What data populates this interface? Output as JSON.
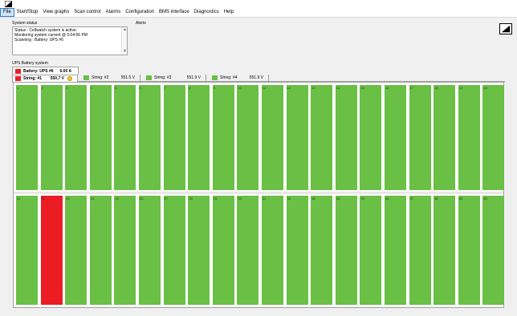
{
  "menu": [
    "File",
    "Start/Stop",
    "View graphs",
    "Scan control",
    "Alarms",
    "Configuration",
    "BMS interface",
    "Diagnostics",
    "Help"
  ],
  "system_status": {
    "label": "System status",
    "lines": [
      "Status : Cellwatch system is active.",
      "Monitoring system current @ 5:04:56 PM",
      "Scanning : Battery: UPS #6"
    ]
  },
  "alerts_label": "Alerts",
  "ups_label": "UPS Battery system",
  "battery": {
    "name": "Battery: UPS #6",
    "current": "6.00 A",
    "color": "#ec1c24"
  },
  "strings": [
    {
      "name": "String: #1",
      "voltage": "550.7 V",
      "color": "#ec1c24",
      "warning": true
    },
    {
      "name": "String: #2",
      "voltage": "551.5 V",
      "color": "#6abf45"
    },
    {
      "name": "String: #3",
      "voltage": "551.9 V",
      "color": "#6abf45"
    },
    {
      "name": "String: #4",
      "voltage": "551.9 V",
      "color": "#6abf45"
    }
  ],
  "cells": [
    {
      "n": "1",
      "status": "ok"
    },
    {
      "n": "2",
      "status": "ok"
    },
    {
      "n": "3",
      "status": "ok"
    },
    {
      "n": "4",
      "status": "ok"
    },
    {
      "n": "5",
      "status": "ok"
    },
    {
      "n": "6",
      "status": "ok"
    },
    {
      "n": "7",
      "status": "ok"
    },
    {
      "n": "8",
      "status": "ok"
    },
    {
      "n": "9",
      "status": "ok"
    },
    {
      "n": "10",
      "status": "ok"
    },
    {
      "n": "11",
      "status": "ok"
    },
    {
      "n": "12",
      "status": "ok"
    },
    {
      "n": "13",
      "status": "ok"
    },
    {
      "n": "14",
      "status": "ok"
    },
    {
      "n": "15",
      "status": "ok"
    },
    {
      "n": "16",
      "status": "ok"
    },
    {
      "n": "17",
      "status": "ok"
    },
    {
      "n": "18",
      "status": "ok"
    },
    {
      "n": "19",
      "status": "ok"
    },
    {
      "n": "20",
      "status": "ok"
    },
    {
      "n": "21",
      "status": "ok"
    },
    {
      "n": "22",
      "status": "alarm"
    },
    {
      "n": "23",
      "status": "ok"
    },
    {
      "n": "24",
      "status": "ok"
    },
    {
      "n": "25",
      "status": "ok"
    },
    {
      "n": "26",
      "status": "ok"
    },
    {
      "n": "27",
      "status": "ok"
    },
    {
      "n": "28",
      "status": "ok"
    },
    {
      "n": "29",
      "status": "ok"
    },
    {
      "n": "30",
      "status": "ok"
    },
    {
      "n": "31",
      "status": "ok"
    },
    {
      "n": "32",
      "status": "ok"
    },
    {
      "n": "33",
      "status": "ok"
    },
    {
      "n": "34",
      "status": "ok"
    },
    {
      "n": "35",
      "status": "ok"
    },
    {
      "n": "36",
      "status": "ok"
    },
    {
      "n": "37",
      "status": "ok"
    },
    {
      "n": "38",
      "status": "ok"
    },
    {
      "n": "39",
      "status": "ok"
    },
    {
      "n": "40",
      "status": "ok"
    }
  ],
  "colors": {
    "ok": "#6abf45",
    "alarm": "#ec1c24"
  }
}
